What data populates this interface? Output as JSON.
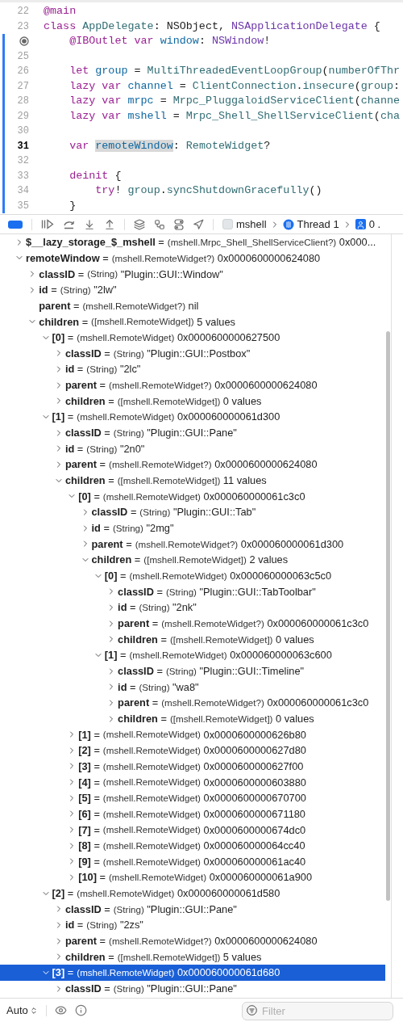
{
  "editor": {
    "lines": [
      {
        "kind": "numbered",
        "number": "22",
        "changed": false,
        "tokens": [
          {
            "text": "@main",
            "kind": "keyword"
          }
        ]
      },
      {
        "kind": "numbered",
        "number": "23",
        "changed": false,
        "tokens": [
          {
            "text": "class ",
            "kind": "keyword"
          },
          {
            "text": "AppDelegate",
            "kind": "project"
          },
          {
            "text": ": NSObject, "
          },
          {
            "text": "NSApplicationDelegate",
            "kind": "type"
          },
          {
            "text": " {"
          }
        ]
      },
      {
        "kind": "outlet",
        "changed": true,
        "tokens": [
          {
            "text": "    @IBOutlet ",
            "kind": "keyword"
          },
          {
            "text": "var ",
            "kind": "keyword"
          },
          {
            "text": "window",
            "kind": "decl"
          },
          {
            "text": ": "
          },
          {
            "text": "NSWindow",
            "kind": "type"
          },
          {
            "text": "!"
          }
        ]
      },
      {
        "kind": "numbered",
        "number": "25",
        "changed": true
      },
      {
        "kind": "numbered",
        "number": "26",
        "changed": true,
        "tokens": [
          {
            "text": "    let ",
            "kind": "keyword"
          },
          {
            "text": "group",
            "kind": "decl"
          },
          {
            "text": " = "
          },
          {
            "text": "MultiThreadedEventLoopGroup",
            "kind": "project"
          },
          {
            "text": "("
          },
          {
            "text": "numberOfThr",
            "kind": "project"
          }
        ]
      },
      {
        "kind": "numbered",
        "number": "27",
        "changed": true,
        "tokens": [
          {
            "text": "    lazy ",
            "kind": "keyword"
          },
          {
            "text": "var ",
            "kind": "keyword"
          },
          {
            "text": "channel",
            "kind": "decl"
          },
          {
            "text": " = "
          },
          {
            "text": "ClientConnection",
            "kind": "project"
          },
          {
            "text": "."
          },
          {
            "text": "insecure",
            "kind": "project"
          },
          {
            "text": "("
          },
          {
            "text": "group",
            "kind": "project"
          },
          {
            "text": ":"
          }
        ]
      },
      {
        "kind": "numbered",
        "number": "28",
        "changed": true,
        "tokens": [
          {
            "text": "    lazy ",
            "kind": "keyword"
          },
          {
            "text": "var ",
            "kind": "keyword"
          },
          {
            "text": "mrpc",
            "kind": "decl"
          },
          {
            "text": " = "
          },
          {
            "text": "Mrpc_PluggaloidServiceClient",
            "kind": "project"
          },
          {
            "text": "("
          },
          {
            "text": "channe",
            "kind": "project"
          }
        ]
      },
      {
        "kind": "numbered",
        "number": "29",
        "changed": true,
        "tokens": [
          {
            "text": "    lazy ",
            "kind": "keyword"
          },
          {
            "text": "var ",
            "kind": "keyword"
          },
          {
            "text": "mshell",
            "kind": "decl"
          },
          {
            "text": " = "
          },
          {
            "text": "Mrpc_Shell_ShellServiceClient",
            "kind": "project"
          },
          {
            "text": "("
          },
          {
            "text": "cha",
            "kind": "project"
          }
        ]
      },
      {
        "kind": "numbered",
        "number": "30",
        "changed": true
      },
      {
        "kind": "numbered",
        "number": "31",
        "changed": true,
        "current": true,
        "tokens": [
          {
            "text": "    var ",
            "kind": "keyword"
          },
          {
            "text": "remoteWindow",
            "kind": "decl",
            "highlighted": true
          },
          {
            "text": ": "
          },
          {
            "text": "RemoteWidget",
            "kind": "project"
          },
          {
            "text": "?"
          }
        ]
      },
      {
        "kind": "numbered",
        "number": "32",
        "changed": true
      },
      {
        "kind": "numbered",
        "number": "33",
        "changed": true,
        "tokens": [
          {
            "text": "    deinit",
            "kind": "keyword"
          },
          {
            "text": " {"
          }
        ]
      },
      {
        "kind": "numbered",
        "number": "34",
        "changed": true,
        "tokens": [
          {
            "text": "        try",
            "kind": "keyword"
          },
          {
            "text": "! "
          },
          {
            "text": "group",
            "kind": "project"
          },
          {
            "text": "."
          },
          {
            "text": "syncShutdownGracefully",
            "kind": "project"
          },
          {
            "text": "()"
          }
        ]
      },
      {
        "kind": "numbered",
        "number": "35",
        "changed": true,
        "tokens": [
          {
            "text": "    }"
          }
        ]
      }
    ]
  },
  "debug_bar": {
    "breakpoints_active": true,
    "process": "mshell",
    "thread": "Thread 1",
    "frame": "0 ."
  },
  "variables": [
    {
      "name": "**$__lazy_storage_$_mshell** =",
      "type": "(mshell.Mrpc_Shell_ShellServiceClient?)",
      "value": "0x000...",
      "expanded": false,
      "selected": false
    },
    {
      "name": "**remoteWindow** =",
      "type": "(mshell.RemoteWidget?)",
      "value": "0x0000600000624080",
      "expanded": true,
      "selected": false,
      "children": [
        {
          "name": "**classID** =",
          "type": "(String)",
          "value": "\"Plugin::GUI::Window\"",
          "expanded": false,
          "selected": false
        },
        {
          "name": "**id** =",
          "type": "(String)",
          "value": "\"2lw\"",
          "expanded": false,
          "selected": false
        },
        {
          "kind": "leaf",
          "name": "**parent** =",
          "type": "(mshell.RemoteWidget?)",
          "value": "nil",
          "selected": false
        },
        {
          "name": "**children** =",
          "type": "([mshell.RemoteWidget])",
          "value": "5 values",
          "expanded": true,
          "selected": false,
          "children": [
            {
              "name": "**[0]** =",
              "type": "(mshell.RemoteWidget)",
              "value": "0x0000600000627500",
              "expanded": true,
              "selected": false,
              "children": [
                {
                  "name": "**classID** =",
                  "type": "(String)",
                  "value": "\"Plugin::GUI::Postbox\"",
                  "expanded": false,
                  "selected": false
                },
                {
                  "name": "**id** =",
                  "type": "(String)",
                  "value": "\"2lc\"",
                  "expanded": false,
                  "selected": false
                },
                {
                  "name": "**parent** =",
                  "type": "(mshell.RemoteWidget?)",
                  "value": "0x0000600000624080",
                  "expanded": false,
                  "selected": false
                },
                {
                  "name": "**children** =",
                  "type": "([mshell.RemoteWidget])",
                  "value": "0 values",
                  "expanded": false,
                  "selected": false
                }
              ]
            },
            {
              "name": "**[1]** =",
              "type": "(mshell.RemoteWidget)",
              "value": "0x000060000061d300",
              "expanded": true,
              "selected": false,
              "children": [
                {
                  "name": "**classID** =",
                  "type": "(String)",
                  "value": "\"Plugin::GUI::Pane\"",
                  "expanded": false,
                  "selected": false
                },
                {
                  "name": "**id** =",
                  "type": "(String)",
                  "value": "\"2n0\"",
                  "expanded": false,
                  "selected": false
                },
                {
                  "name": "**parent** =",
                  "type": "(mshell.RemoteWidget?)",
                  "value": "0x0000600000624080",
                  "expanded": false,
                  "selected": false
                },
                {
                  "name": "**children** =",
                  "type": "([mshell.RemoteWidget])",
                  "value": "11 values",
                  "expanded": true,
                  "selected": false,
                  "children": [
                    {
                      "name": "**[0]** =",
                      "type": "(mshell.RemoteWidget)",
                      "value": "0x000060000061c3c0",
                      "expanded": true,
                      "selected": false,
                      "children": [
                        {
                          "name": "**classID** =",
                          "type": "(String)",
                          "value": "\"Plugin::GUI::Tab\"",
                          "expanded": false,
                          "selected": false
                        },
                        {
                          "name": "**id** =",
                          "type": "(String)",
                          "value": "\"2mg\"",
                          "expanded": false,
                          "selected": false
                        },
                        {
                          "name": "**parent** =",
                          "type": "(mshell.RemoteWidget?)",
                          "value": "0x000060000061d300",
                          "expanded": false,
                          "selected": false
                        },
                        {
                          "name": "**children** =",
                          "type": "([mshell.RemoteWidget])",
                          "value": "2 values",
                          "expanded": true,
                          "selected": false,
                          "children": [
                            {
                              "name": "**[0]** =",
                              "type": "(mshell.RemoteWidget)",
                              "value": "0x000060000063c5c0",
                              "expanded": true,
                              "selected": false,
                              "children": [
                                {
                                  "name": "**classID** =",
                                  "type": "(String)",
                                  "value": "\"Plugin::GUI::TabToolbar\"",
                                  "expanded": false,
                                  "selected": false
                                },
                                {
                                  "name": "**id** =",
                                  "type": "(String)",
                                  "value": "\"2nk\"",
                                  "expanded": false,
                                  "selected": false
                                },
                                {
                                  "name": "**parent** =",
                                  "type": "(mshell.RemoteWidget?)",
                                  "value": "0x000060000061c3c0",
                                  "expanded": false,
                                  "selected": false
                                },
                                {
                                  "name": "**children** =",
                                  "type": "([mshell.RemoteWidget])",
                                  "value": "0 values",
                                  "expanded": false,
                                  "selected": false
                                }
                              ]
                            },
                            {
                              "name": "**[1]** =",
                              "type": "(mshell.RemoteWidget)",
                              "value": "0x000060000063c600",
                              "expanded": true,
                              "selected": false,
                              "children": [
                                {
                                  "name": "**classID** =",
                                  "type": "(String)",
                                  "value": "\"Plugin::GUI::Timeline\"",
                                  "expanded": false,
                                  "selected": false
                                },
                                {
                                  "name": "**id** =",
                                  "type": "(String)",
                                  "value": "\"wa8\"",
                                  "expanded": false,
                                  "selected": false
                                },
                                {
                                  "name": "**parent** =",
                                  "type": "(mshell.RemoteWidget?)",
                                  "value": "0x000060000061c3c0",
                                  "expanded": false,
                                  "selected": false
                                },
                                {
                                  "name": "**children** =",
                                  "type": "([mshell.RemoteWidget])",
                                  "value": "0 values",
                                  "expanded": false,
                                  "selected": false
                                }
                              ]
                            }
                          ]
                        }
                      ]
                    },
                    {
                      "name": "**[1]** =",
                      "type": "(mshell.RemoteWidget)",
                      "value": "0x0000600000626b80",
                      "expanded": false,
                      "selected": false
                    },
                    {
                      "name": "**[2]** =",
                      "type": "(mshell.RemoteWidget)",
                      "value": "0x0000600000627d80",
                      "expanded": false,
                      "selected": false
                    },
                    {
                      "name": "**[3]** =",
                      "type": "(mshell.RemoteWidget)",
                      "value": "0x0000600000627f00",
                      "expanded": false,
                      "selected": false
                    },
                    {
                      "name": "**[4]** =",
                      "type": "(mshell.RemoteWidget)",
                      "value": "0x0000600000603880",
                      "expanded": false,
                      "selected": false
                    },
                    {
                      "name": "**[5]** =",
                      "type": "(mshell.RemoteWidget)",
                      "value": "0x0000600000670700",
                      "expanded": false,
                      "selected": false
                    },
                    {
                      "name": "**[6]** =",
                      "type": "(mshell.RemoteWidget)",
                      "value": "0x0000600000671180",
                      "expanded": false,
                      "selected": false
                    },
                    {
                      "name": "**[7]** =",
                      "type": "(mshell.RemoteWidget)",
                      "value": "0x0000600000674dc0",
                      "expanded": false,
                      "selected": false
                    },
                    {
                      "name": "**[8]** =",
                      "type": "(mshell.RemoteWidget)",
                      "value": "0x000060000064cc40",
                      "expanded": false,
                      "selected": false
                    },
                    {
                      "name": "**[9]** =",
                      "type": "(mshell.RemoteWidget)",
                      "value": "0x000060000061ac40",
                      "expanded": false,
                      "selected": false
                    },
                    {
                      "name": "**[10]** =",
                      "type": "(mshell.RemoteWidget)",
                      "value": "0x000060000061a900",
                      "expanded": false,
                      "selected": false
                    }
                  ]
                }
              ]
            },
            {
              "name": "**[2]** =",
              "type": "(mshell.RemoteWidget)",
              "value": "0x000060000061d580",
              "expanded": true,
              "selected": false,
              "children": [
                {
                  "name": "**classID** =",
                  "type": "(String)",
                  "value": "\"Plugin::GUI::Pane\"",
                  "expanded": false,
                  "selected": false
                },
                {
                  "name": "**id** =",
                  "type": "(String)",
                  "value": "\"2zs\"",
                  "expanded": false,
                  "selected": false
                },
                {
                  "name": "**parent** =",
                  "type": "(mshell.RemoteWidget?)",
                  "value": "0x0000600000624080",
                  "expanded": false,
                  "selected": false
                },
                {
                  "name": "**children** =",
                  "type": "([mshell.RemoteWidget])",
                  "value": "5 values",
                  "expanded": false,
                  "selected": false
                }
              ]
            },
            {
              "name": "**[3]** =",
              "type": "(mshell.RemoteWidget)",
              "value": "0x000060000061d680",
              "expanded": true,
              "selected": true,
              "children": [
                {
                  "name": "**classID** =",
                  "type": "(String)",
                  "value": "\"Plugin::GUI::Pane\"",
                  "expanded": false,
                  "selected": false
                }
              ]
            }
          ]
        }
      ]
    }
  ],
  "bottom_bar": {
    "scope": "Auto",
    "filter": {
      "placeholder": "Filter"
    }
  }
}
